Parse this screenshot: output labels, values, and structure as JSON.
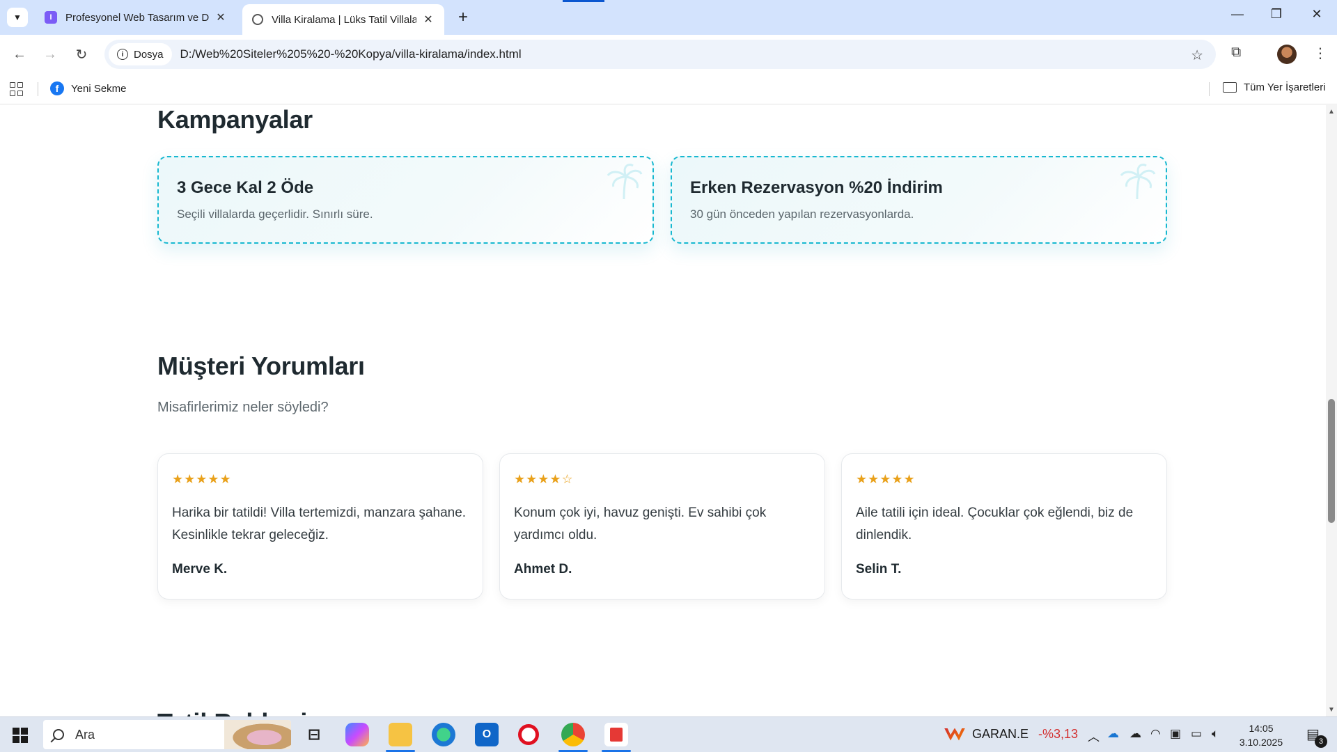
{
  "browser": {
    "tabs": [
      {
        "title": "Profesyonel Web Tasarım ve Dij",
        "favicon": "app-icon",
        "active": false
      },
      {
        "title": "Villa Kiralama | Lüks Tatil Villaları",
        "favicon": "globe-icon",
        "active": true
      }
    ],
    "new_tab": "+",
    "omnibox": {
      "security_label": "Dosya",
      "url": "D:/Web%20Siteler%205%20-%20Kopya/villa-kiralama/index.html"
    },
    "bookmarks": [
      {
        "label": "Yeni Sekme",
        "icon": "facebook-icon"
      }
    ],
    "all_bookmarks_label": "Tüm Yer İşaretleri"
  },
  "page": {
    "campaigns": {
      "title": "Kampanyalar",
      "items": [
        {
          "title": "3 Gece Kal 2 Öde",
          "desc": "Seçili villalarda geçerlidir. Sınırlı süre."
        },
        {
          "title": "Erken Rezervasyon %20 İndirim",
          "desc": "30 gün önceden yapılan rezervasyonlarda."
        }
      ]
    },
    "reviews": {
      "title": "Müşteri Yorumları",
      "subtitle": "Misafirlerimiz neler söyledi?",
      "items": [
        {
          "stars": "★★★★★",
          "rating": 5,
          "text": "Harika bir tatildi! Villa tertemizdi, manzara şahane. Kesinlikle tekrar geleceğiz.",
          "author": "Merve K."
        },
        {
          "stars": "★★★★☆",
          "rating": 4,
          "text": "Konum çok iyi, havuz genişti. Ev sahibi çok yardımcı oldu.",
          "author": "Ahmet D."
        },
        {
          "stars": "★★★★★",
          "rating": 5,
          "text": "Aile tatili için ideal. Çocuklar çok eğlendi, biz de dinlendik.",
          "author": "Selin T."
        }
      ]
    },
    "next_section_title_partial": "Tatil Rehberi"
  },
  "taskbar": {
    "search_placeholder": "Ara",
    "stock": {
      "symbol": "GARAN.E",
      "change": "-%3,13"
    },
    "time": "14:05",
    "date": "3.10.2025",
    "notifications": "3"
  },
  "colors": {
    "promo_border": "#17b8d0",
    "star_color": "#e9a11b",
    "heading": "#1f2a30"
  }
}
